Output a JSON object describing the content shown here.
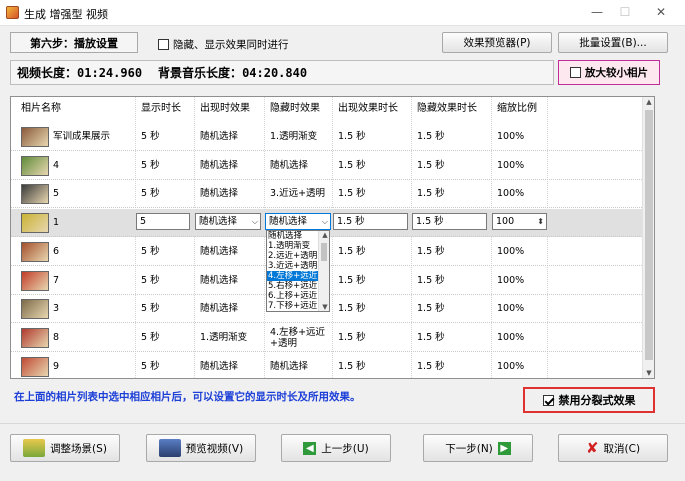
{
  "window": {
    "title": "生成 增强型 视频",
    "minimize": "—",
    "maximize": "☐",
    "close": "✕"
  },
  "header": {
    "step_label": "第六步：播放设置",
    "sync_checkbox_label": "隐藏、显示效果同时进行",
    "preview_button": "效果预览器(P)",
    "batch_button": "批量设置(B)..."
  },
  "info": {
    "video_length_label": "视频长度：",
    "video_length": "01:24.960",
    "music_length_label": "背景音乐长度：",
    "music_length": "04:20.840",
    "enlarge_label": "放大较小相片"
  },
  "table": {
    "columns": [
      "相片名称",
      "显示时长",
      "出现时效果",
      "隐藏时效果",
      "出现效果时长",
      "隐藏效果时长",
      "缩放比例"
    ],
    "rows": [
      {
        "name": "军训成果展示",
        "show": "5 秒",
        "appear": "随机选择",
        "hide": "1.透明渐变",
        "appear_dur": "1.5 秒",
        "hide_dur": "1.5 秒",
        "scale": "100%",
        "thumb": "#8a5a3b"
      },
      {
        "name": "4",
        "show": "5 秒",
        "appear": "随机选择",
        "hide": "随机选择",
        "appear_dur": "1.5 秒",
        "hide_dur": "1.5 秒",
        "scale": "100%",
        "thumb": "#5f8c3a"
      },
      {
        "name": "5",
        "show": "5 秒",
        "appear": "随机选择",
        "hide": "3.近远+透明",
        "appear_dur": "1.5 秒",
        "hide_dur": "1.5 秒",
        "scale": "100%",
        "thumb": "#3b3b3b"
      },
      {
        "name": "1",
        "show": "5",
        "appear": "随机选择",
        "hide": "随机选择",
        "appear_dur": "1.5 秒",
        "hide_dur": "1.5 秒",
        "scale": "100",
        "thumb": "#c9b233",
        "selected": true
      },
      {
        "name": "6",
        "show": "5 秒",
        "appear": "随机选择",
        "hide": "",
        "appear_dur": "1.5 秒",
        "hide_dur": "1.5 秒",
        "scale": "100%",
        "thumb": "#a4502c"
      },
      {
        "name": "7",
        "show": "5 秒",
        "appear": "随机选择",
        "hide": "",
        "appear_dur": "1.5 秒",
        "hide_dur": "1.5 秒",
        "scale": "100%",
        "thumb": "#c23d2a"
      },
      {
        "name": "3",
        "show": "5 秒",
        "appear": "随机选择",
        "hide": "",
        "appear_dur": "1.5 秒",
        "hide_dur": "1.5 秒",
        "scale": "100%",
        "thumb": "#7d6a4a"
      },
      {
        "name": "8",
        "show": "5 秒",
        "appear": "1.透明渐变",
        "hide": "4.左移+远近+透明",
        "appear_dur": "1.5 秒",
        "hide_dur": "1.5 秒",
        "scale": "100%",
        "thumb": "#b0392e"
      },
      {
        "name": "9",
        "show": "5 秒",
        "appear": "随机选择",
        "hide": "随机选择",
        "appear_dur": "1.5 秒",
        "hide_dur": "1.5 秒",
        "scale": "100%",
        "thumb": "#c04a35"
      }
    ],
    "dropdown_options": [
      "随机选择",
      "1.透明渐变",
      "2.远近+透明",
      "3.近远+透明",
      "4.左移+远近",
      "5.右移+远近",
      "6.上移+远近",
      "7.下移+远近"
    ],
    "dropdown_highlighted": 4
  },
  "footer": {
    "hint": "在上面的相片列表中选中相应相片后，可以设置它的显示时长及所用效果。",
    "disable_split_label": "禁用分裂式效果",
    "adjust_scene": "调整场景(S)",
    "preview_video": "预览视频(V)",
    "prev_step": "上一步(U)",
    "next_step": "下一步(N)",
    "cancel": "取消(C)"
  }
}
